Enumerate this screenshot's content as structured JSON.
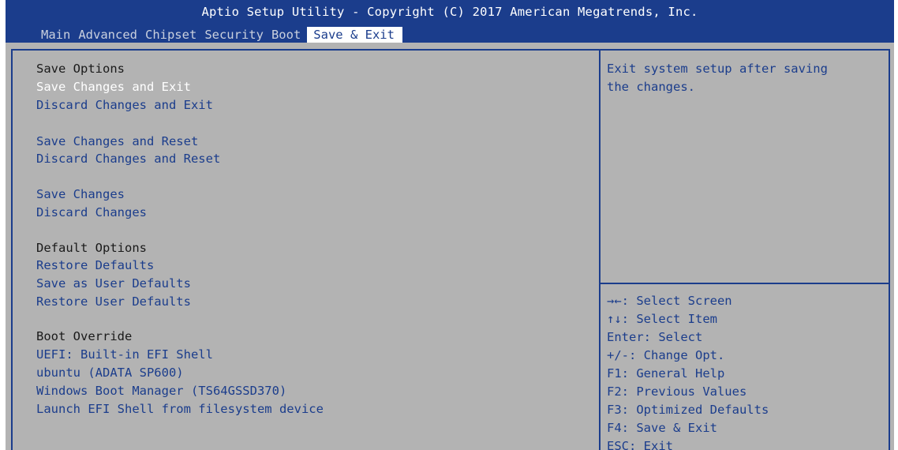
{
  "app": {
    "title": "Aptio Setup Utility - Copyright (C) 2017 American Megatrends, Inc."
  },
  "tabs": [
    {
      "label": "Main"
    },
    {
      "label": "Advanced"
    },
    {
      "label": "Chipset"
    },
    {
      "label": "Security"
    },
    {
      "label": "Boot"
    },
    {
      "label": "Save & Exit"
    }
  ],
  "active_tab": "Save & Exit",
  "menu": {
    "save_options_heading": "Save Options",
    "save_changes_and_exit": "Save Changes and Exit",
    "discard_changes_and_exit": "Discard Changes and Exit",
    "save_changes_and_reset": "Save Changes and Reset",
    "discard_changes_and_reset": "Discard Changes and Reset",
    "save_changes": "Save Changes",
    "discard_changes": "Discard Changes",
    "default_options_heading": "Default Options",
    "restore_defaults": "Restore Defaults",
    "save_as_user_defaults": "Save as User Defaults",
    "restore_user_defaults": "Restore User Defaults",
    "boot_override_heading": "Boot Override",
    "uefi_shell": "UEFI: Built-in EFI Shell",
    "ubuntu": "ubuntu (ADATA SP600)",
    "windows_boot_manager": "Windows Boot Manager (TS64GSSD370)",
    "launch_efi_shell": "Launch EFI Shell from filesystem device"
  },
  "help": {
    "line1": "Exit system setup after saving",
    "line2": "the changes."
  },
  "keys": {
    "select_screen": "→←: Select Screen",
    "select_item": "↑↓: Select Item",
    "enter": "Enter: Select",
    "change_opt": "+/-: Change Opt.",
    "f1": "F1: General Help",
    "f2": "F2: Previous Values",
    "f3": "F3: Optimized Defaults",
    "f4": "F4: Save & Exit",
    "esc": "ESC: Exit"
  },
  "colors": {
    "header_bg": "#1b3d8c",
    "body_bg": "#b3b3b3",
    "item_text": "#1b3d8c",
    "selected_text": "#ffffff"
  }
}
